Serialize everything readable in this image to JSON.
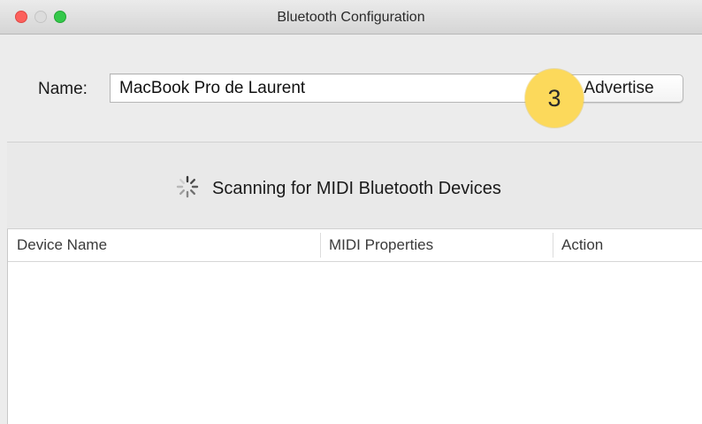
{
  "window": {
    "title": "Bluetooth Configuration"
  },
  "form": {
    "name_label": "Name:",
    "name_value": "MacBook Pro de Laurent",
    "advertise_label": "Advertise"
  },
  "badge": {
    "number": "3",
    "color": "#fcd95b"
  },
  "scan": {
    "status_text": "Scanning for MIDI Bluetooth Devices",
    "icon": "spinner-icon"
  },
  "table": {
    "columns": [
      "Device Name",
      "MIDI Properties",
      "Action"
    ],
    "rows": []
  },
  "colors": {
    "close": "#fc605c",
    "minimize": "#dcdcdc",
    "zoom": "#34c84a"
  }
}
